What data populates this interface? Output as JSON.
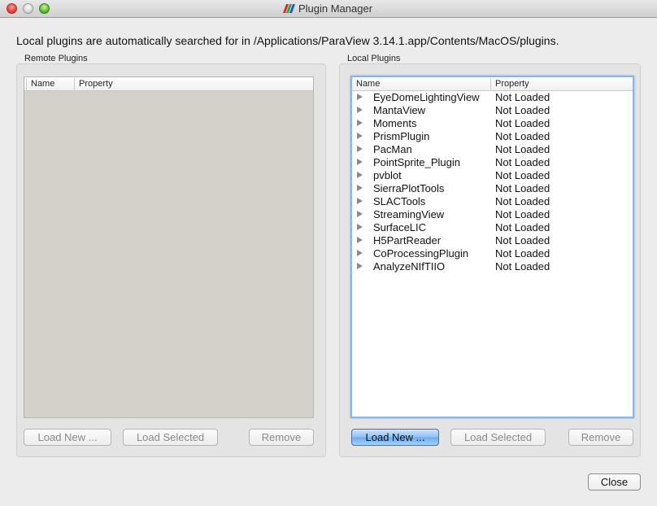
{
  "window": {
    "title": "Plugin Manager",
    "logo_colors": [
      "#d8262c",
      "#2fa343",
      "#2a4fc9"
    ]
  },
  "info_text": "Local plugins are automatically searched for in /Applications/ParaView 3.14.1.app/Contents/MacOS/plugins.",
  "remote": {
    "label": "Remote Plugins",
    "columns": [
      "Name",
      "Property"
    ],
    "rows": [],
    "buttons": {
      "load_new": "Load New ...",
      "load_selected": "Load Selected",
      "remove": "Remove"
    }
  },
  "local": {
    "label": "Local Plugins",
    "columns": [
      "Name",
      "Property"
    ],
    "rows": [
      {
        "name": "EyeDomeLightingView",
        "property": "Not Loaded"
      },
      {
        "name": "MantaView",
        "property": "Not Loaded"
      },
      {
        "name": "Moments",
        "property": "Not Loaded"
      },
      {
        "name": "PrismPlugin",
        "property": "Not Loaded"
      },
      {
        "name": "PacMan",
        "property": "Not Loaded"
      },
      {
        "name": "PointSprite_Plugin",
        "property": "Not Loaded"
      },
      {
        "name": "pvblot",
        "property": "Not Loaded"
      },
      {
        "name": "SierraPlotTools",
        "property": "Not Loaded"
      },
      {
        "name": "SLACTools",
        "property": "Not Loaded"
      },
      {
        "name": "StreamingView",
        "property": "Not Loaded"
      },
      {
        "name": "SurfaceLIC",
        "property": "Not Loaded"
      },
      {
        "name": "H5PartReader",
        "property": "Not Loaded"
      },
      {
        "name": "CoProcessingPlugin",
        "property": "Not Loaded"
      },
      {
        "name": "AnalyzeNIfTIIO",
        "property": "Not Loaded"
      }
    ],
    "buttons": {
      "load_new": "Load New ...",
      "load_selected": "Load Selected",
      "remove": "Remove"
    }
  },
  "close_label": "Close"
}
